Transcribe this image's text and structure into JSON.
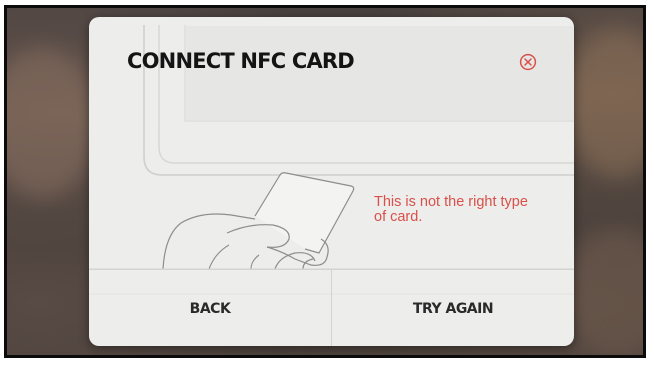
{
  "dialog": {
    "title": "CONNECT NFC CARD",
    "close_icon": "close-circle-icon",
    "message": "This is not the right type of card.",
    "illustration": "hand-holding-card-illustration"
  },
  "buttons": {
    "back_label": "BACK",
    "retry_label": "TRY AGAIN"
  },
  "colors": {
    "accent": "#d9504a",
    "dialog_bg": "#ededec",
    "title": "#141414"
  }
}
